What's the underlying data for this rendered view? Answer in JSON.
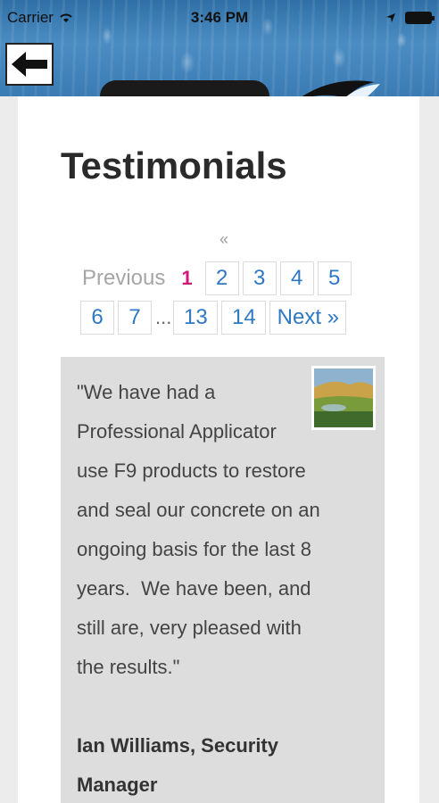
{
  "status_bar": {
    "carrier": "Carrier",
    "time": "3:46 PM"
  },
  "header": {
    "back_icon": "arrow-left-icon"
  },
  "page": {
    "title": "Testimonials"
  },
  "pager": {
    "prev_arrow": "«",
    "previous_label": "Previous",
    "current_page": "1",
    "row1_pages": [
      "2",
      "3",
      "4",
      "5"
    ],
    "row2_pages_a": [
      "6",
      "7"
    ],
    "ellipsis": "...",
    "row2_pages_b": [
      "13",
      "14"
    ],
    "next_label": "Next »",
    "link_color": "#2f78c4",
    "current_color": "#d4177a"
  },
  "testimonial": {
    "quote_lines": [
      "\"We have had a",
      "Professional Applicator",
      "use F9 products to restore",
      "and seal our concrete on an",
      "ongoing basis for the last 8",
      "years.  We have been, and",
      "still are, very pleased with",
      "the results.\""
    ],
    "author_lines": [
      "Ian Williams, Security",
      "Manager"
    ]
  }
}
